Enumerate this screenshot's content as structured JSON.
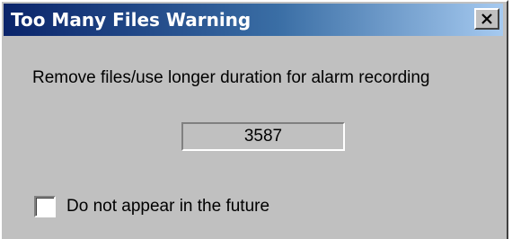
{
  "window": {
    "title": "Too Many Files Warning",
    "close_icon": "close-icon"
  },
  "message": "Remove files/use longer duration for alarm recording",
  "file_count": "3587",
  "checkbox": {
    "label": "Do not appear in the future",
    "checked": false
  },
  "colors": {
    "titlebar_start": "#0a246a",
    "titlebar_end": "#a6caf0",
    "face": "#c0c0c0"
  }
}
